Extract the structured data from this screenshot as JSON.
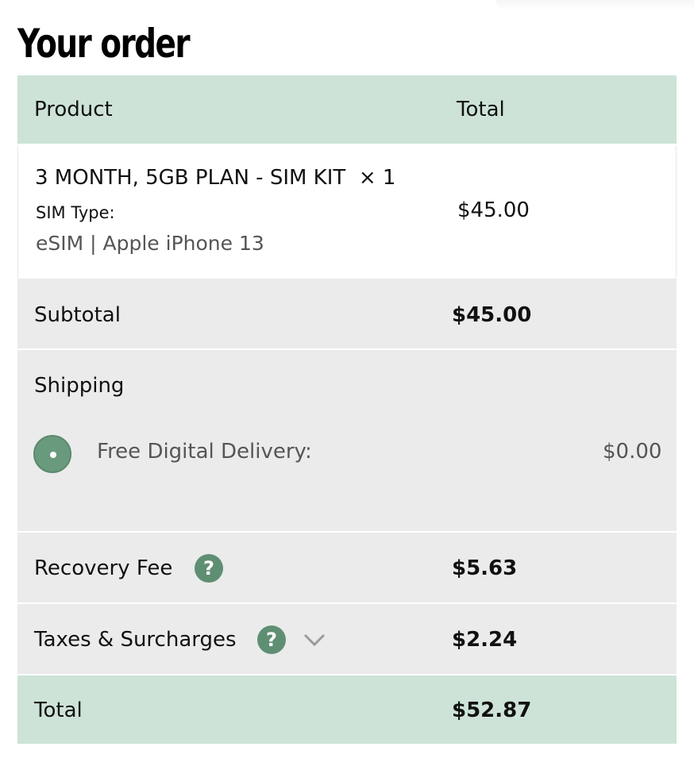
{
  "page_title": "Your order",
  "table": {
    "header": {
      "product": "Product",
      "total": "Total"
    },
    "item": {
      "name": "3 MONTH, 5GB PLAN - SIM KIT",
      "quantity": "× 1",
      "meta_label": "SIM Type:",
      "meta_value": "eSIM | Apple iPhone 13",
      "price": "$45.00"
    },
    "subtotal": {
      "label": "Subtotal",
      "value": "$45.00"
    },
    "shipping": {
      "label": "Shipping",
      "option_label": "Free Digital Delivery:",
      "option_value": "$0.00",
      "option_selected": true
    },
    "recovery_fee": {
      "label": "Recovery Fee",
      "value": "$5.63",
      "help_icon": "question-circle-icon"
    },
    "taxes": {
      "label": "Taxes & Surcharges",
      "value": "$2.24",
      "help_icon": "question-circle-icon",
      "expand_icon": "chevron-down-icon"
    },
    "total": {
      "label": "Total",
      "value": "$52.87"
    }
  },
  "colors": {
    "header_green": "#cde3d7",
    "row_gray": "#ebebeb",
    "accent_green": "#5f8f72"
  }
}
